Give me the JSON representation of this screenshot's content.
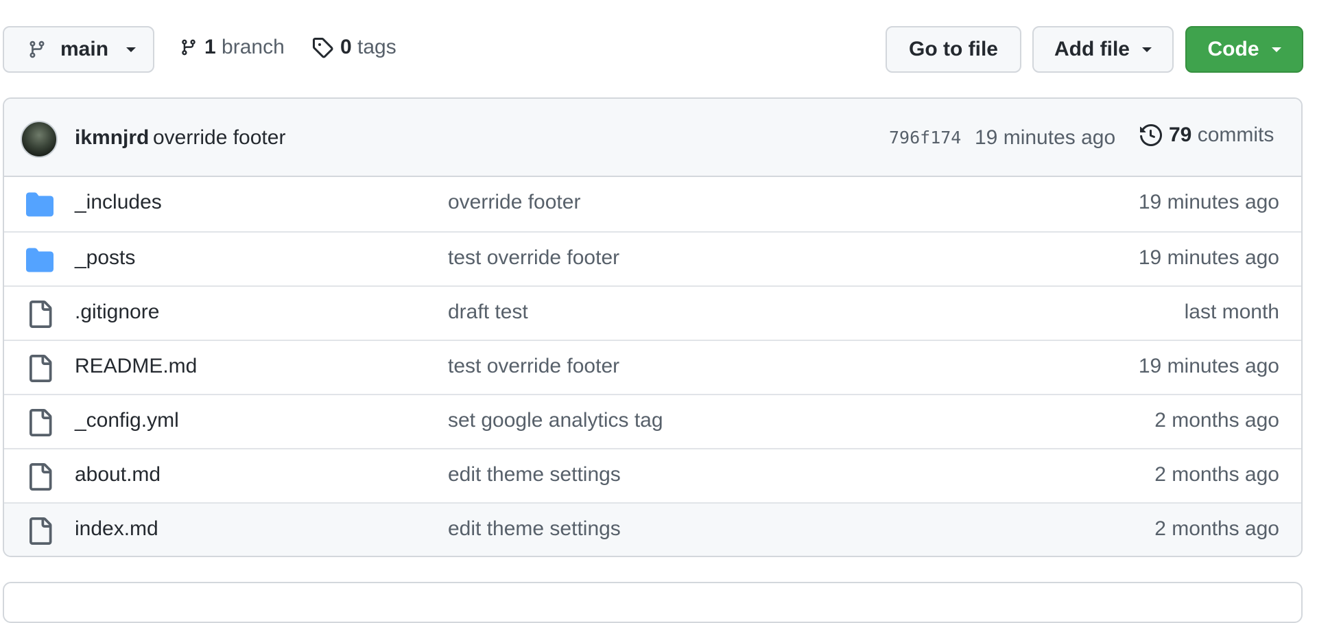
{
  "toolbar": {
    "branch_button": {
      "icon": "git-branch-icon",
      "label": "main"
    },
    "branches": {
      "icon": "git-branch-icon",
      "count": "1",
      "label": "branch"
    },
    "tags": {
      "icon": "tag-icon",
      "count": "0",
      "label": "tags"
    },
    "go_to_file_label": "Go to file",
    "add_file_label": "Add file",
    "code_label": "Code"
  },
  "latest_commit": {
    "author": "ikmnjrd",
    "message": "override footer",
    "sha": "796f174",
    "time": "19 minutes ago",
    "commits_icon": "history-icon",
    "commit_count": "79",
    "commit_label": "commits"
  },
  "files": [
    {
      "type": "dir",
      "icon": "folder-icon",
      "name": "_includes",
      "message": "override footer",
      "date": "19 minutes ago"
    },
    {
      "type": "dir",
      "icon": "folder-icon",
      "name": "_posts",
      "message": "test override footer",
      "date": "19 minutes ago"
    },
    {
      "type": "file",
      "icon": "file-icon",
      "name": ".gitignore",
      "message": "draft test",
      "date": "last month"
    },
    {
      "type": "file",
      "icon": "file-icon",
      "name": "README.md",
      "message": "test override footer",
      "date": "19 minutes ago"
    },
    {
      "type": "file",
      "icon": "file-icon",
      "name": "_config.yml",
      "message": "set google analytics tag",
      "date": "2 months ago"
    },
    {
      "type": "file",
      "icon": "file-icon",
      "name": "about.md",
      "message": "edit theme settings",
      "date": "2 months ago"
    },
    {
      "type": "file",
      "icon": "file-icon",
      "name": "index.md",
      "message": "edit theme settings",
      "date": "2 months ago"
    }
  ],
  "colors": {
    "code_button_bg": "#3fa34d",
    "folder_icon": "#54a3ff",
    "muted_text": "#57606a",
    "border": "#d3d7dc"
  }
}
